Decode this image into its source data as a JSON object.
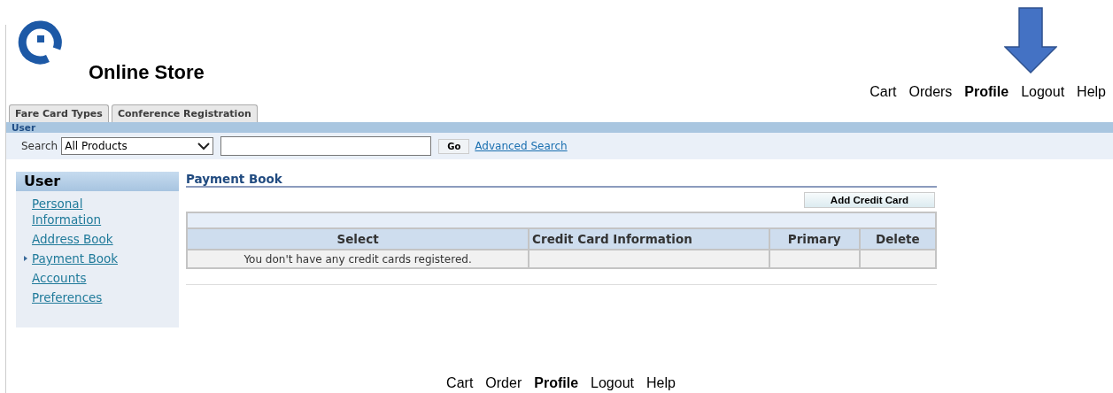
{
  "header": {
    "title": "Online Store",
    "nav": [
      {
        "label": "Cart",
        "selected": false
      },
      {
        "label": "Orders",
        "selected": false
      },
      {
        "label": "Profile",
        "selected": true
      },
      {
        "label": "Logout",
        "selected": false
      },
      {
        "label": "Help",
        "selected": false
      }
    ]
  },
  "tabs": [
    {
      "label": "Fare Card Types",
      "selected": false
    },
    {
      "label": "Conference Registration",
      "selected": false
    }
  ],
  "subtab_bar": {
    "label": "User"
  },
  "search": {
    "label": "Search",
    "category": "All Products",
    "button": "Go",
    "advanced_link": "Advanced Search"
  },
  "sidebar": {
    "title": "User",
    "items": [
      {
        "label": "Personal Information",
        "selected": false
      },
      {
        "label": "Address Book",
        "selected": false
      },
      {
        "label": "Payment Book",
        "selected": true
      },
      {
        "label": "Accounts",
        "selected": false
      },
      {
        "label": "Preferences",
        "selected": false
      }
    ]
  },
  "content": {
    "title": "Payment Book",
    "add_button": "Add Credit Card",
    "table": {
      "columns": [
        "Select",
        "Credit Card Information",
        "Primary",
        "Delete"
      ],
      "rows": [
        [
          "You don't have any credit cards registered.",
          "",
          "",
          ""
        ]
      ]
    }
  },
  "footer": {
    "nav": [
      {
        "label": "Cart",
        "selected": false
      },
      {
        "label": "Order",
        "selected": false
      },
      {
        "label": "Profile",
        "selected": true
      },
      {
        "label": "Logout",
        "selected": false
      },
      {
        "label": "Help",
        "selected": false
      }
    ]
  }
}
